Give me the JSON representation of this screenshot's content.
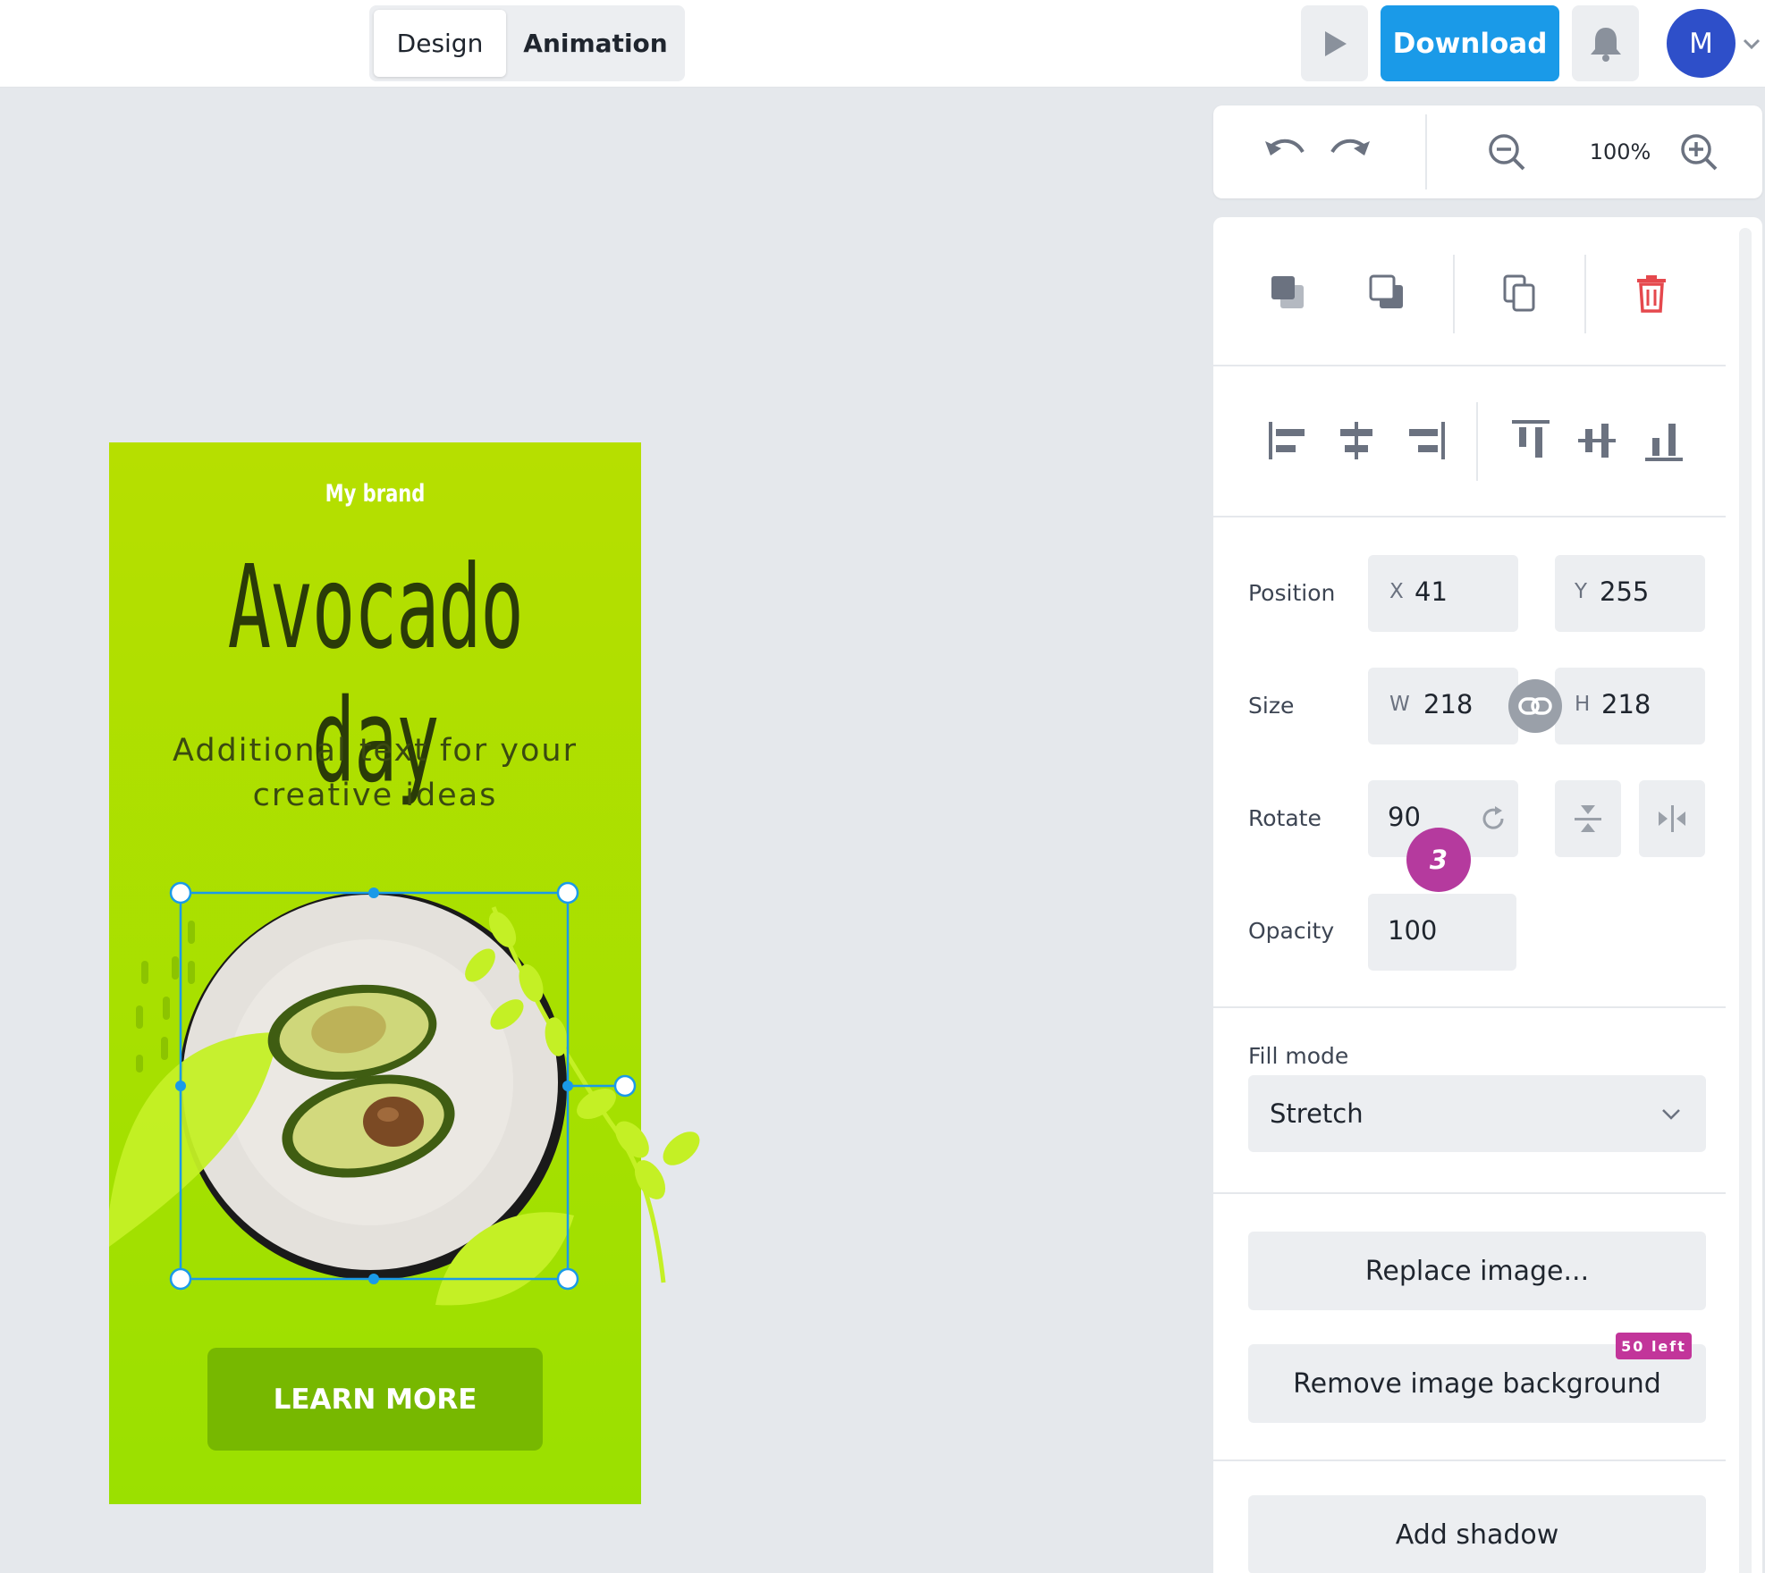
{
  "topbar": {
    "tabs": [
      {
        "label": "Design"
      },
      {
        "label": "Animation"
      }
    ],
    "download_label": "Download",
    "avatar_initial": "M"
  },
  "zoom": {
    "level": "100%"
  },
  "panel": {
    "position_label": "Position",
    "x_prefix": "X",
    "x_value": "41",
    "y_prefix": "Y",
    "y_value": "255",
    "size_label": "Size",
    "w_prefix": "W",
    "w_value": "218",
    "h_prefix": "H",
    "h_value": "218",
    "rotate_label": "Rotate",
    "rotate_value": "90",
    "opacity_label": "Opacity",
    "opacity_value": "100",
    "fill_mode_label": "Fill mode",
    "fill_mode_value": "Stretch",
    "replace_image_label": "Replace image...",
    "remove_bg_label": "Remove image background",
    "remove_bg_badge": "50 left",
    "add_shadow_label": "Add shadow"
  },
  "design": {
    "brand": "My brand",
    "headline": "Avocado day",
    "subtext_line1": "Additional text for your",
    "subtext_line2": "creative ideas",
    "cta": "LEARN MORE"
  },
  "step_badge": "3",
  "colors": {
    "accent": "#1a9ae8",
    "badge": "#b53a9e",
    "design_green": "#a9e000",
    "cta_green": "#77b800",
    "selection": "#1a9ae8",
    "delete": "#e5484d"
  }
}
